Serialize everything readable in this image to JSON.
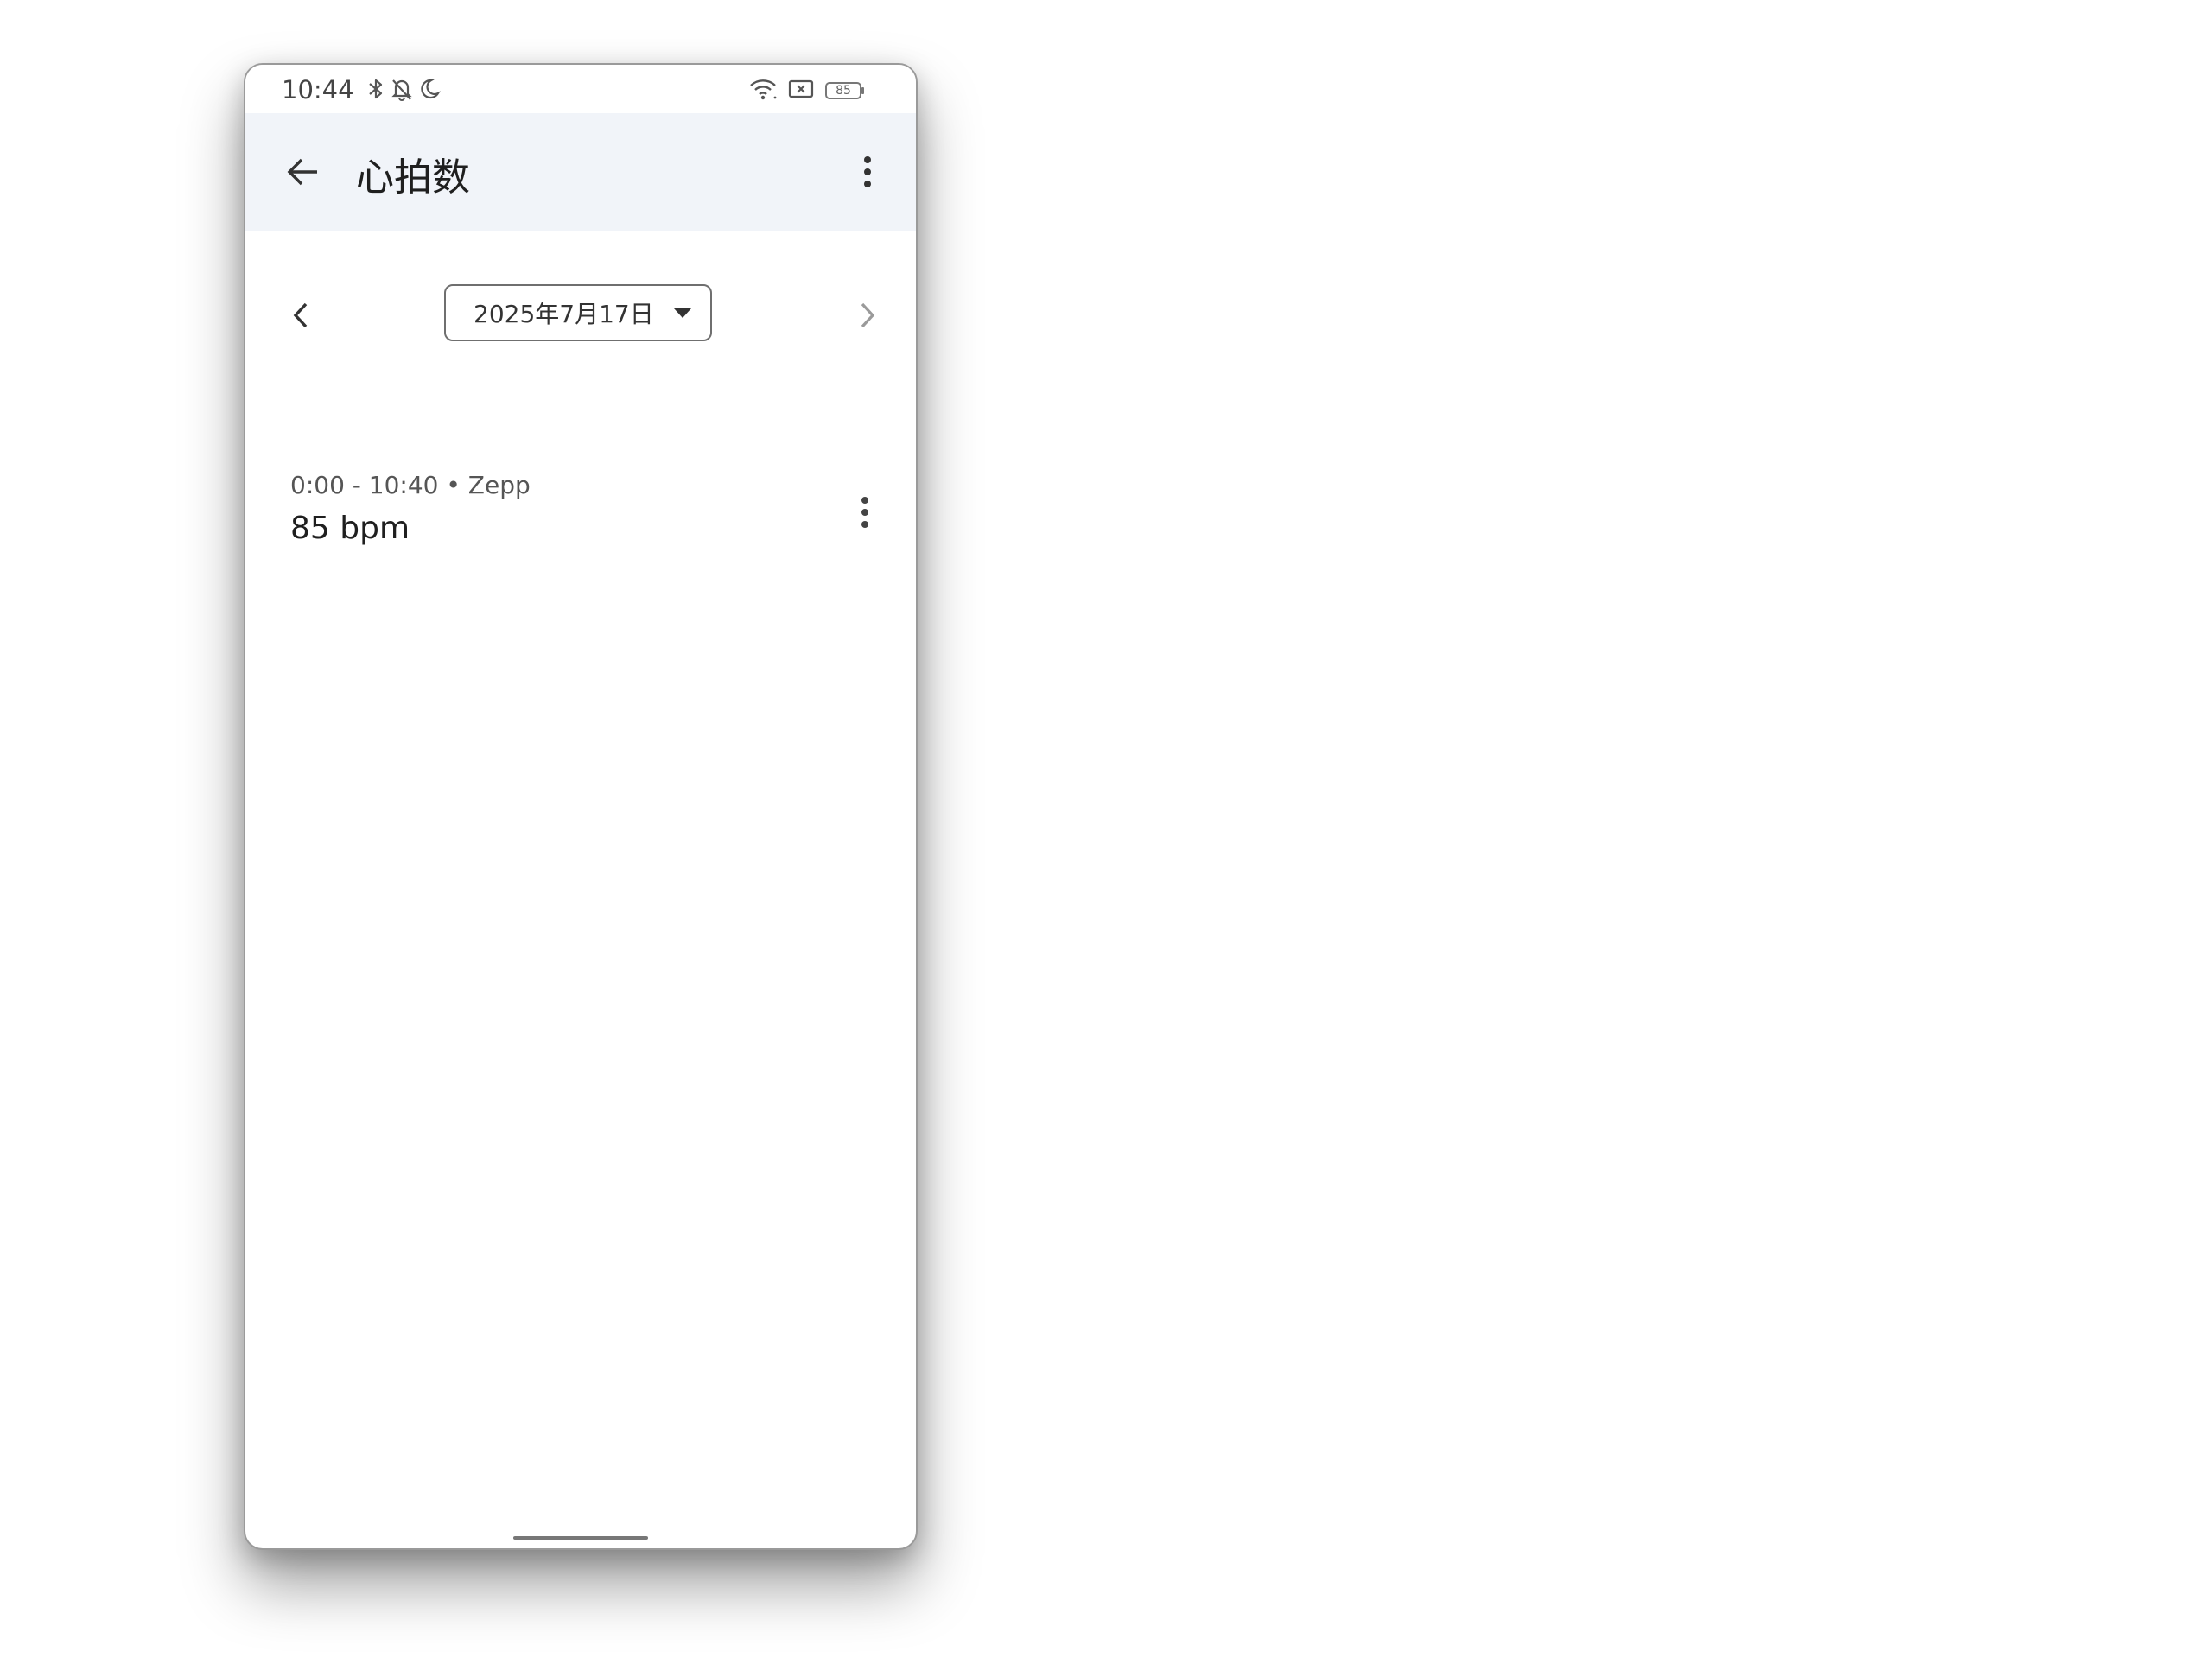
{
  "status_bar": {
    "time": "10:44",
    "battery_level": "85",
    "icons_left": [
      "bluetooth-icon",
      "bell-off-icon",
      "moon-icon"
    ],
    "icons_right": [
      "wifi-icon",
      "screen-cast-icon",
      "battery-icon"
    ]
  },
  "app_bar": {
    "title": "心拍数"
  },
  "date_nav": {
    "date": "2025年7月17日"
  },
  "records": [
    {
      "meta": "0:00 - 10:40 • Zepp",
      "value": "85 bpm"
    }
  ],
  "colors": {
    "app_bar_bg": "#f1f4f9",
    "text_primary": "#1f1f1f",
    "text_secondary": "#555555"
  }
}
